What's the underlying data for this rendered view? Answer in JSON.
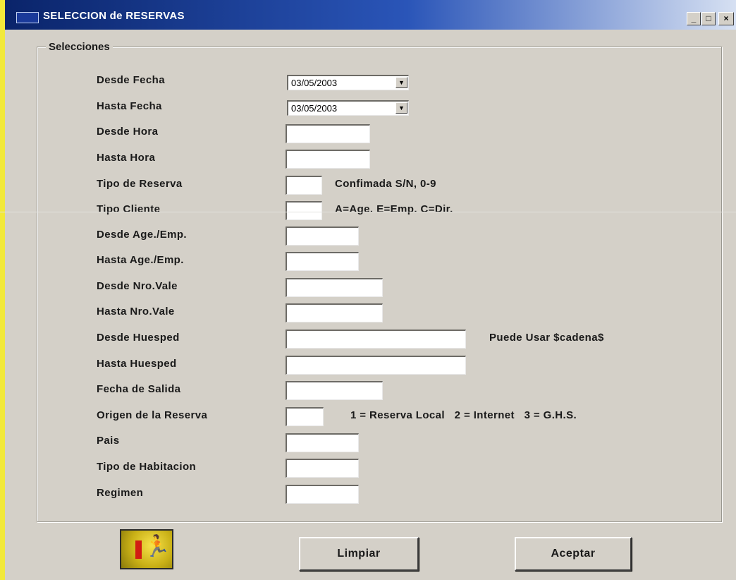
{
  "window": {
    "title": "SELECCION de RESERVAS",
    "min_glyph": "_",
    "max_glyph": "□",
    "close_glyph": "×"
  },
  "group": {
    "label": "Selecciones"
  },
  "fields": {
    "desde_fecha": {
      "label": "Desde Fecha",
      "value": "03/05/2003"
    },
    "hasta_fecha": {
      "label": "Hasta Fecha",
      "value": "03/05/2003"
    },
    "desde_hora": {
      "label": "Desde Hora",
      "value": ""
    },
    "hasta_hora": {
      "label": "Hasta Hora",
      "value": ""
    },
    "tipo_reserva": {
      "label": "Tipo de Reserva",
      "value": "",
      "hint": "Confimada S/N, 0-9"
    },
    "tipo_cliente": {
      "label": "Tipo Cliente",
      "value": "",
      "hint": "A=Age. E=Emp. C=Dir."
    },
    "desde_age_emp": {
      "label": "Desde Age./Emp.",
      "value": ""
    },
    "hasta_age_emp": {
      "label": "Hasta Age./Emp.",
      "value": ""
    },
    "desde_nro_vale": {
      "label": "Desde Nro.Vale",
      "value": ""
    },
    "hasta_nro_vale": {
      "label": "Hasta Nro.Vale",
      "value": ""
    },
    "desde_huesped": {
      "label": "Desde Huesped",
      "value": "",
      "hint": "Puede Usar  $cadena$"
    },
    "hasta_huesped": {
      "label": "Hasta Huesped",
      "value": ""
    },
    "fecha_salida": {
      "label": "Fecha de Salida",
      "value": ""
    },
    "origen_reserva": {
      "label": "Origen de la Reserva",
      "value": "",
      "hint": "1 = Reserva Local   2 = Internet   3 = G.H.S."
    },
    "pais": {
      "label": "Pais",
      "value": ""
    },
    "tipo_habitacion": {
      "label": "Tipo de Habitacion",
      "value": ""
    },
    "regimen": {
      "label": "Regimen",
      "value": ""
    }
  },
  "buttons": {
    "limpiar": "Limpiar",
    "aceptar": "Aceptar",
    "exit_icon": "exit-door-running-man-icon"
  },
  "colors": {
    "titlebar": "#0a246a",
    "window_bg": "#d4d0c8",
    "exit_bg": "#e0c828"
  }
}
